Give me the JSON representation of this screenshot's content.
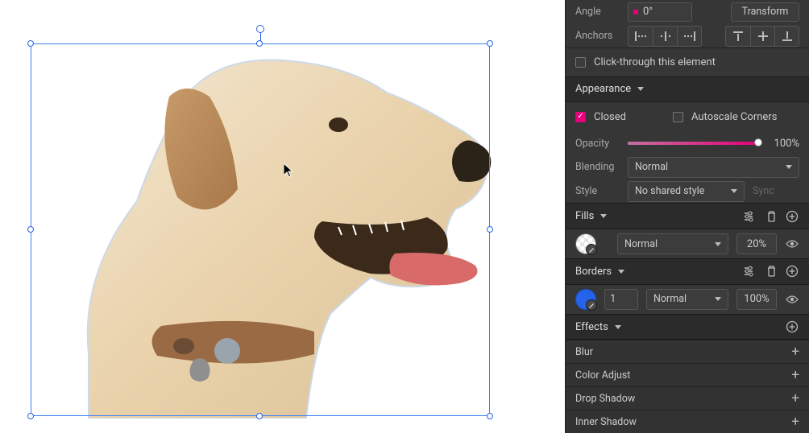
{
  "transform": {
    "angle_label": "Angle",
    "angle_value": "0°",
    "transform_btn": "Transform",
    "anchors_label": "Anchors"
  },
  "clickthrough_label": "Click-through this element",
  "appearance": {
    "title": "Appearance",
    "closed_label": "Closed",
    "autoscale_label": "Autoscale Corners",
    "opacity_label": "Opacity",
    "opacity_value": "100%",
    "blending_label": "Blending",
    "blending_value": "Normal",
    "style_label": "Style",
    "style_value": "No shared style",
    "sync_label": "Sync"
  },
  "fills": {
    "title": "Fills",
    "mode": "Normal",
    "opacity": "20%"
  },
  "borders": {
    "title": "Borders",
    "width": "1",
    "mode": "Normal",
    "opacity": "100%"
  },
  "effects": {
    "title": "Effects",
    "items": [
      "Blur",
      "Color Adjust",
      "Drop Shadow",
      "Inner Shadow"
    ]
  }
}
